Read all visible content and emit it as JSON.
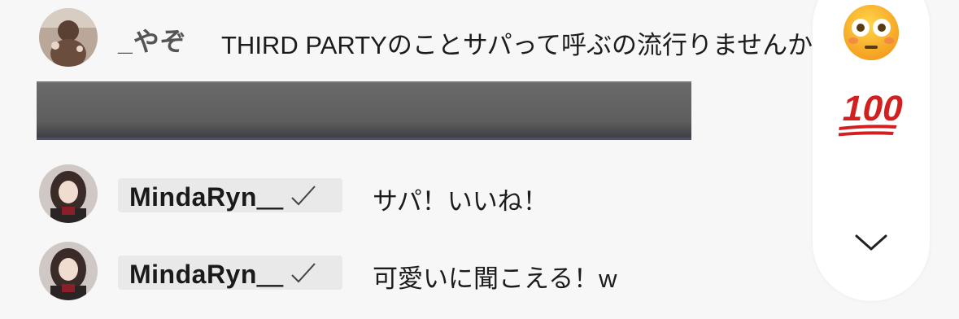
{
  "comments": [
    {
      "username": "_やぞ",
      "verified": false,
      "text": "THIRD PARTYのことサパって呼ぶの流行りませんか？"
    },
    {
      "username": "MindaRyn＿",
      "verified": true,
      "text": "サパ！いいね！"
    },
    {
      "username": "MindaRyn＿",
      "verified": true,
      "text": "可愛いに聞こえる！w"
    }
  ],
  "reactions": {
    "items": [
      {
        "icon": "flushed-face-icon"
      },
      {
        "icon": "hundred-points-icon",
        "label": "100"
      },
      {
        "icon": "chevron-down-icon"
      }
    ]
  },
  "colors": {
    "background": "#f7f7f7",
    "badge_background": "#e9e9e9",
    "hundred_red": "#d21f1f",
    "emoji_yellow": "#f7b52c"
  }
}
